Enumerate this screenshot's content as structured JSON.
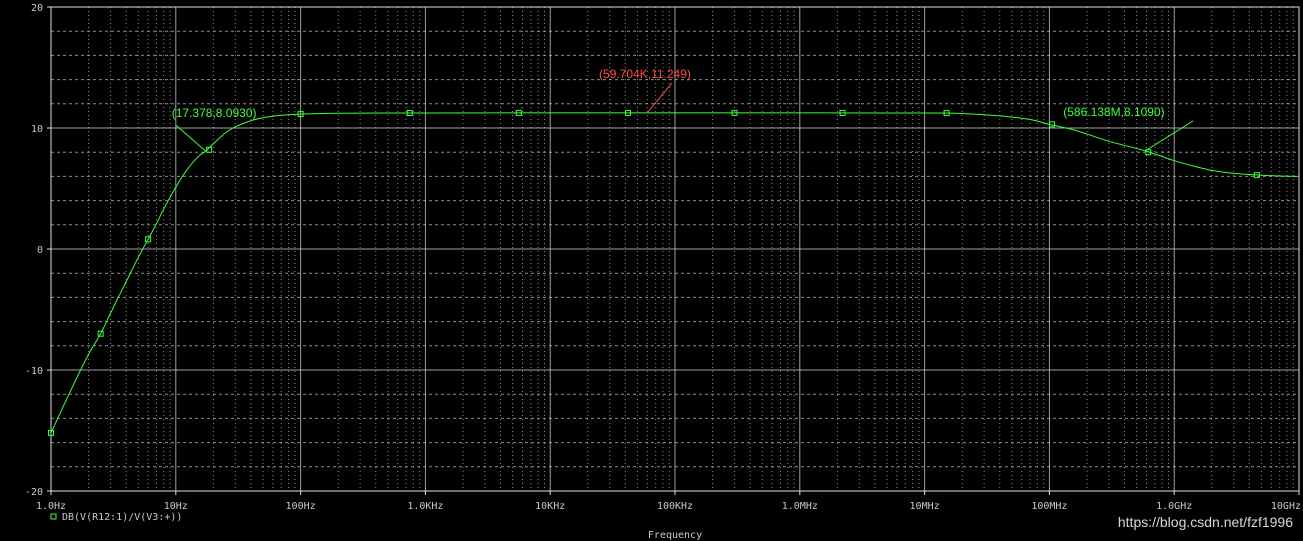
{
  "colors": {
    "background": "#000000",
    "frame": "#e0e0e0",
    "grid": "#c8c8c8",
    "trace": "#3dff3d",
    "annotation_green": "#3dff3d",
    "annotation_red": "#ff4a4a"
  },
  "chart_data": {
    "type": "line",
    "title": "",
    "xlabel": "Frequency",
    "ylabel": "",
    "x_scale": "log",
    "xlim": [
      1,
      10000000000
    ],
    "ylim": [
      -20,
      20
    ],
    "grid": true,
    "x_ticks": [
      {
        "value": 1,
        "label": "1.0Hz"
      },
      {
        "value": 10,
        "label": "10Hz"
      },
      {
        "value": 100,
        "label": "100Hz"
      },
      {
        "value": 1000,
        "label": "1.0KHz"
      },
      {
        "value": 10000,
        "label": "10KHz"
      },
      {
        "value": 100000,
        "label": "100KHz"
      },
      {
        "value": 1000000,
        "label": "1.0MHz"
      },
      {
        "value": 10000000,
        "label": "10MHz"
      },
      {
        "value": 100000000,
        "label": "100MHz"
      },
      {
        "value": 1000000000,
        "label": "1.0GHz"
      },
      {
        "value": 10000000000,
        "label": "10GHz"
      }
    ],
    "y_ticks": [
      {
        "value": 20,
        "label": "20"
      },
      {
        "value": 10,
        "label": "10"
      },
      {
        "value": 0,
        "label": "0"
      },
      {
        "value": -10,
        "label": "-10"
      },
      {
        "value": -20,
        "label": "-20"
      }
    ],
    "series": [
      {
        "name": "DB(V(R12:1)/V(V3:+))",
        "marker": "square",
        "points": [
          [
            1,
            -15.2
          ],
          [
            1.5,
            -11.3
          ],
          [
            2,
            -8.7
          ],
          [
            2.5,
            -7.0
          ],
          [
            3,
            -5.3
          ],
          [
            4,
            -2.7
          ],
          [
            5,
            -0.7
          ],
          [
            6,
            0.8
          ],
          [
            7,
            2.1
          ],
          [
            8,
            3.3
          ],
          [
            10,
            5.1
          ],
          [
            12,
            6.4
          ],
          [
            15,
            7.6
          ],
          [
            17.378,
            8.093
          ],
          [
            20,
            8.7
          ],
          [
            25,
            9.6
          ],
          [
            30,
            10.1
          ],
          [
            40,
            10.6
          ],
          [
            50,
            10.85
          ],
          [
            70,
            11.05
          ],
          [
            100,
            11.15
          ],
          [
            200,
            11.22
          ],
          [
            500,
            11.24
          ],
          [
            1000,
            11.245
          ],
          [
            10000,
            11.248
          ],
          [
            59704,
            11.249
          ],
          [
            1000000,
            11.249
          ],
          [
            10000000,
            11.24
          ],
          [
            20000000,
            11.2
          ],
          [
            40000000,
            11.0
          ],
          [
            70000000,
            10.7
          ],
          [
            100000000,
            10.3
          ],
          [
            150000000,
            9.9
          ],
          [
            200000000,
            9.5
          ],
          [
            300000000,
            8.9
          ],
          [
            586138000,
            8.109
          ],
          [
            1000000000,
            7.3
          ],
          [
            1500000000,
            6.8
          ],
          [
            2000000000,
            6.5
          ],
          [
            3000000000,
            6.25
          ],
          [
            5000000000,
            6.1
          ],
          [
            7000000000,
            6.03
          ],
          [
            10000000000,
            6.0
          ]
        ],
        "marker_points": [
          [
            1,
            -15.2
          ],
          [
            2.5,
            -7.0
          ],
          [
            6,
            0.8
          ],
          [
            18.5,
            8.2
          ],
          [
            100,
            11.15
          ],
          [
            750,
            11.24
          ],
          [
            5600,
            11.247
          ],
          [
            42000,
            11.249
          ],
          [
            300000,
            11.249
          ],
          [
            2200000,
            11.249
          ],
          [
            15000000,
            11.23
          ],
          [
            105000000,
            10.3
          ],
          [
            620000000,
            8.0
          ],
          [
            4600000000,
            6.1
          ]
        ]
      }
    ],
    "annotations": [
      {
        "label": "(17.378,8.0930)",
        "x": 17.378,
        "y": 8.093,
        "color": "green"
      },
      {
        "label": "(59.704K,11.249)",
        "x": 59704,
        "y": 11.249,
        "color": "red"
      },
      {
        "label": "(586.138M,8.1090)",
        "x": 586138000,
        "y": 8.109,
        "color": "green"
      }
    ]
  },
  "watermark": "https://blog.csdn.net/fzf1996"
}
